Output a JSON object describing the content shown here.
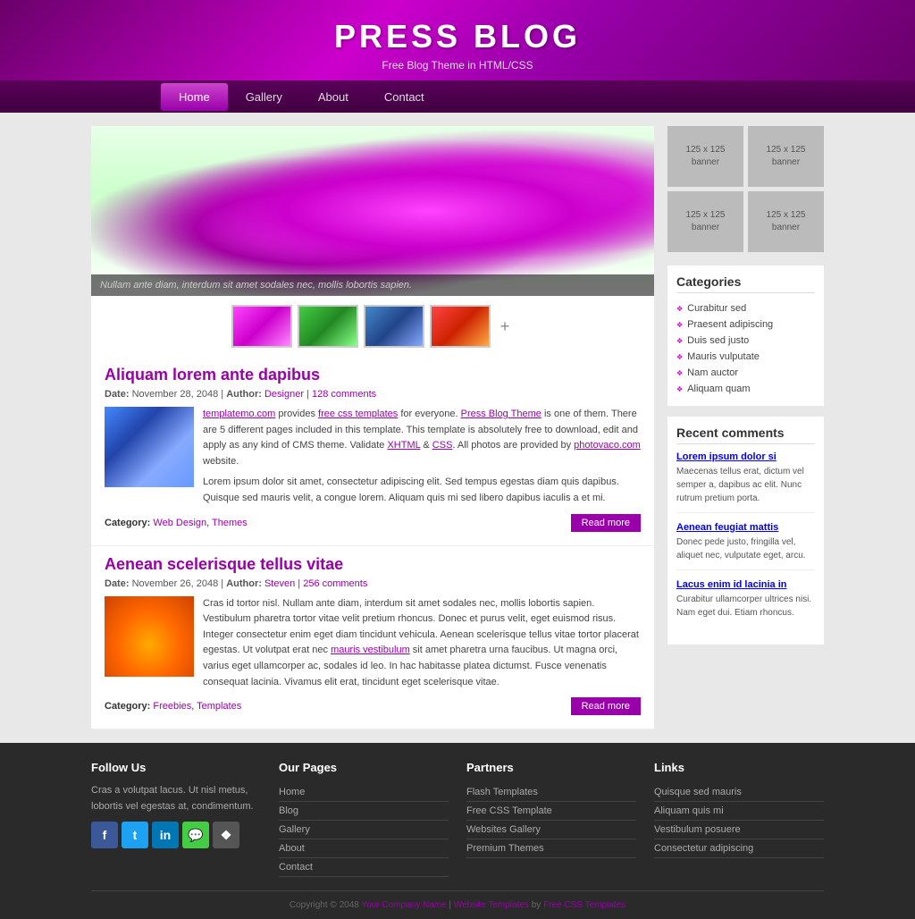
{
  "site": {
    "title": "PRESS BLOG",
    "subtitle": "Free Blog Theme in HTML/CSS"
  },
  "nav": {
    "items": [
      {
        "label": "Home",
        "active": true
      },
      {
        "label": "Gallery",
        "active": false
      },
      {
        "label": "About",
        "active": false
      },
      {
        "label": "Contact",
        "active": false
      }
    ]
  },
  "slider": {
    "caption": "Nullam ante diam, interdum sit amet sodales nec, mollis lobortis sapien.",
    "plus_label": "+"
  },
  "posts": [
    {
      "title": "Aliquam lorem ante dapibus",
      "date": "November 28, 2048",
      "author": "Designer",
      "comments": "128 comments",
      "body_p1": "templatemo.com provides free css templates for everyone. Press Blog Theme is one of them. There are 5 different pages included in this template. This template is absolutely free to download, edit and apply as any kind of CMS theme. Validate XHTML & CSS. All photos are provided by photovaco.com website.",
      "body_p2": "Lorem ipsum dolor sit amet, consectetur adipiscing elit. Sed tempus egestas diam quis dapibus. Quisque sed mauris velit, a congue lorem. Aliquam quis mi sed libero dapibus iaculis a et mi.",
      "categories": [
        "Web Design",
        "Themes"
      ],
      "read_more": "Read more"
    },
    {
      "title": "Aenean scelerisque tellus vitae",
      "date": "November 26, 2048",
      "author": "Steven",
      "comments": "256 comments",
      "body_p1": "Cras id tortor nisl. Nullam ante diam, interdum sit amet sodales nec, mollis lobortis sapien. Vestibulum pharetra tortor vitae velit pretium rhoncus. Donec et purus velit, eget euismod risus. Integer consectetur enim eget diam tincidunt vehicula. Aenean scelerisque tellus vitae tortor placerat egestas. Ut volutpat erat nec mauris vestibulum sit amet pharetra urna faucibus. Ut magna orci, varius eget ullamcorper ac, sodales id leo. In hac habitasse platea dictumst. Fusce venenatis consequat lacinia. Vivamus elit erat, tincidunt eget scelerisque vitae.",
      "categories": [
        "Freebies",
        "Templates"
      ],
      "read_more": "Read more"
    }
  ],
  "sidebar": {
    "banners": [
      {
        "label": "125 x 125\nbanner"
      },
      {
        "label": "125 x 125\nbanner"
      },
      {
        "label": "125 x 125\nbanner"
      },
      {
        "label": "125 x 125\nbanner"
      }
    ],
    "categories_title": "Categories",
    "categories": [
      {
        "label": "Curabitur sed"
      },
      {
        "label": "Praesent adipiscing"
      },
      {
        "label": "Duis sed justo"
      },
      {
        "label": "Mauris vulputate"
      },
      {
        "label": "Nam auctor"
      },
      {
        "label": "Aliquam quam"
      }
    ],
    "recent_comments_title": "Recent comments",
    "recent_comments": [
      {
        "title": "Lorem ipsum dolor si",
        "text": "Maecenas tellus erat, dictum vel semper a, dapibus ac elit. Nunc rutrum pretium porta."
      },
      {
        "title": "Aenean feugiat mattis",
        "text": "Donec pede justo, fringilla vel, aliquet nec, vulputate eget, arcu."
      },
      {
        "title": "Lacus enim id lacinia in",
        "text": "Curabitur ullamcorper ultrices nisi. Nam eget dui. Etiam rhoncus."
      }
    ]
  },
  "footer": {
    "columns": [
      {
        "title": "Follow Us",
        "text": "Cras a volutpat lacus. Ut nisl metus, lobortis vel egestas at, condimentum.",
        "social": [
          {
            "label": "f",
            "class": "si-fb"
          },
          {
            "label": "t",
            "class": "si-tw"
          },
          {
            "label": "in",
            "class": "si-li"
          },
          {
            "label": "💬",
            "class": "si-msg"
          },
          {
            "label": "❖",
            "class": "si-gr"
          }
        ]
      },
      {
        "title": "Our Pages",
        "links": [
          "Home",
          "Blog",
          "Gallery",
          "About",
          "Contact"
        ]
      },
      {
        "title": "Partners",
        "links": [
          "Flash Templates",
          "Free CSS Template",
          "Websites Gallery",
          "Premium Themes"
        ]
      },
      {
        "title": "Links",
        "links": [
          "Quisque sed mauris",
          "Aliquam quis mi",
          "Vestibulum posuere",
          "Consectetur adipiscing"
        ]
      }
    ],
    "copyright": "Copyright © 2048",
    "company": "Your Company Name",
    "sep1": "|",
    "website_templates": "Website Templates",
    "by": "by",
    "free_css": "Free CSS Templates"
  }
}
